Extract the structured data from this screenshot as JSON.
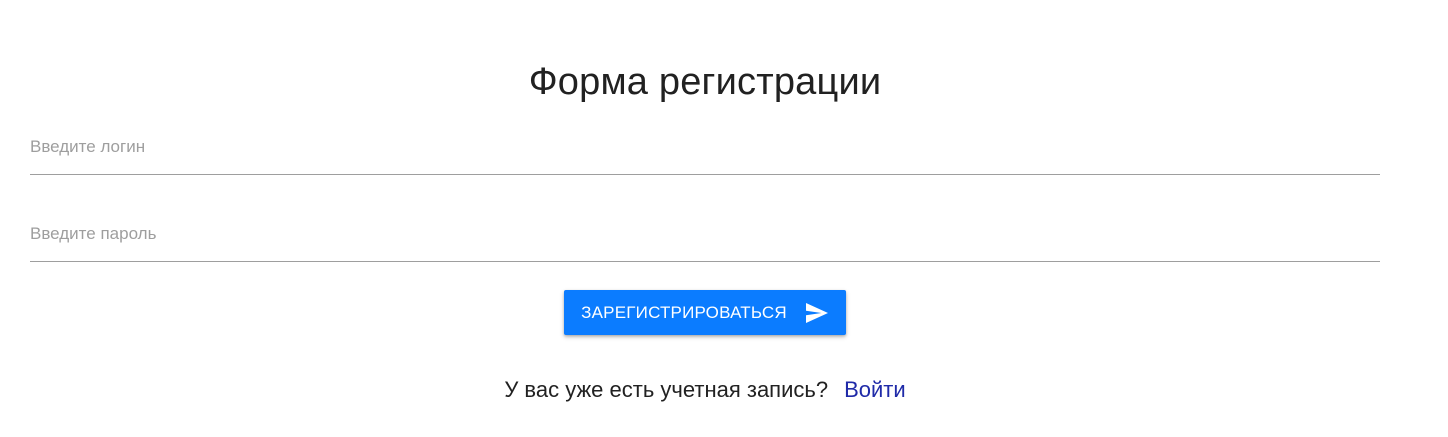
{
  "form": {
    "title": "Форма регистрации",
    "login_placeholder": "Введите логин",
    "login_value": "",
    "password_placeholder": "Введите пароль",
    "password_value": "",
    "submit_label": "ЗАРЕГИСТРИРОВАТЬСЯ",
    "submit_icon": "send-icon",
    "has_account_text": "У вас уже есть учетная запись?",
    "login_link_label": "Войти"
  },
  "colors": {
    "primary": "#0b7cff",
    "link": "#1f2aa8",
    "placeholder": "#9e9e9e",
    "underline": "#9e9e9e"
  }
}
